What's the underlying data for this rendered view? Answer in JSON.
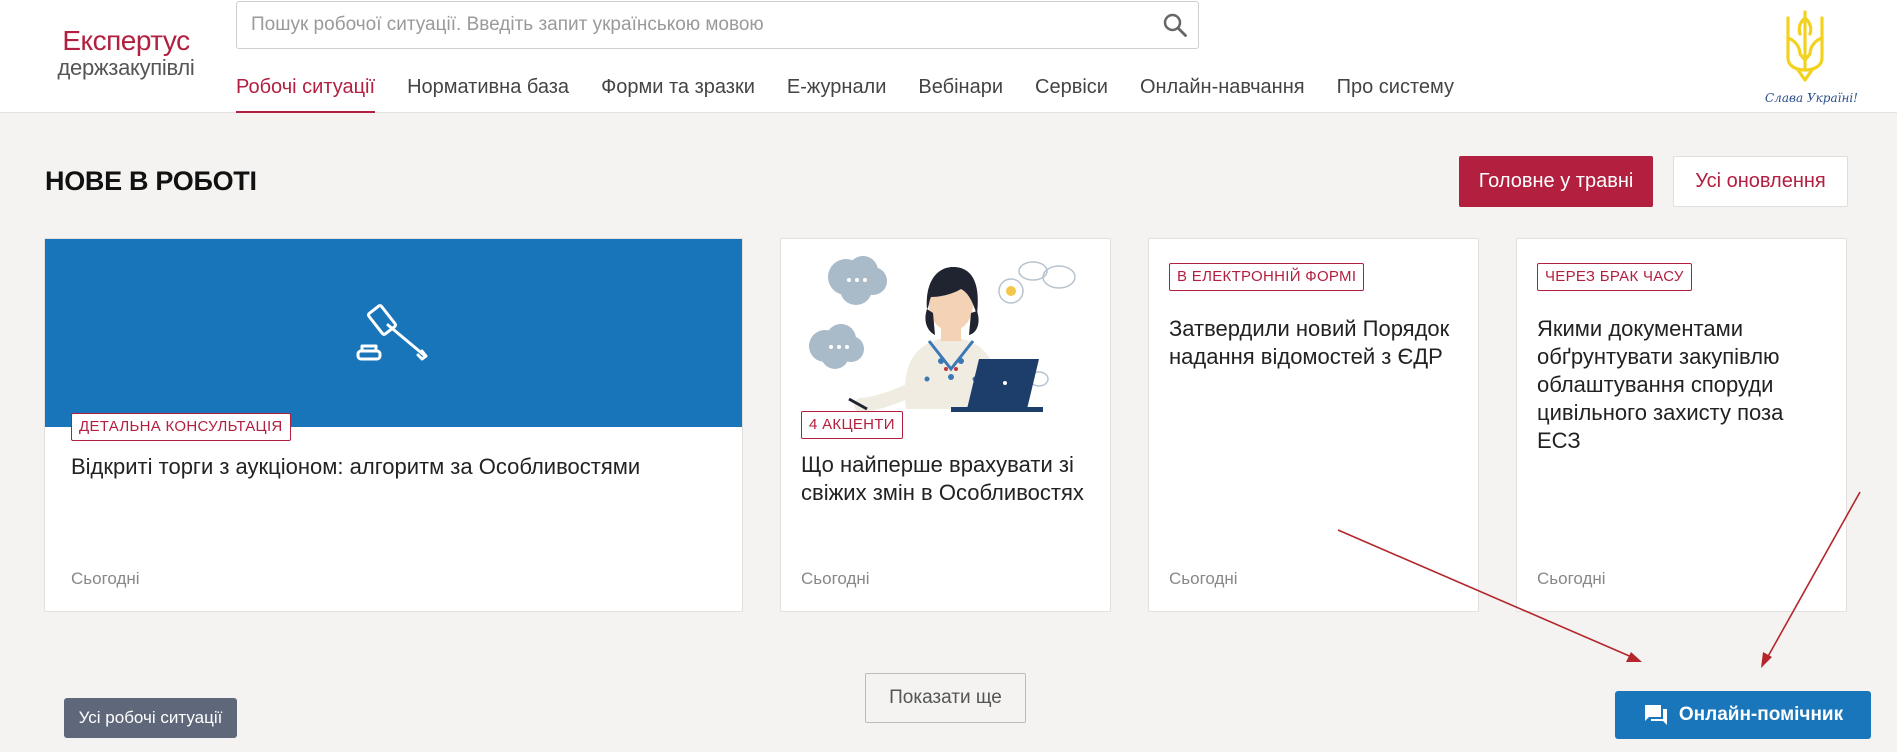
{
  "header": {
    "logo_line1": "Експертус",
    "logo_line2": "держзакупівлі",
    "search_placeholder": "Пошук робочої ситуації. Введіть запит українською мовою",
    "nav": [
      {
        "label": "Робочі ситуації",
        "active": true
      },
      {
        "label": "Нормативна база"
      },
      {
        "label": "Форми та зразки"
      },
      {
        "label": "Е-журнали"
      },
      {
        "label": "Вебінари"
      },
      {
        "label": "Сервіси"
      },
      {
        "label": "Онлайн-навчання"
      },
      {
        "label": "Про систему"
      }
    ],
    "slogan": "Слава Україні!"
  },
  "section": {
    "title": "НОВЕ В РОБОТІ",
    "btn_main": "Головне у травні",
    "btn_all_updates": "Усі оновлення"
  },
  "cards": [
    {
      "tag": "ДЕТАЛЬНА КОНСУЛЬТАЦІЯ",
      "title": "Відкриті торги з аукціоном: алгоритм за Особливостями",
      "date": "Сьогодні"
    },
    {
      "tag": "4 АКЦЕНТИ",
      "title": "Що найперше врахувати зі свіжих змін в Особливостях",
      "date": "Сьогодні"
    },
    {
      "tag": "В ЕЛЕКТРОННІЙ ФОРМІ",
      "title": "Затвердили новий Порядок надання відомостей з ЄДР",
      "date": "Сьогодні"
    },
    {
      "tag": "ЧЕРЕЗ БРАК ЧАСУ",
      "title": "Якими документами обґрунтувати закупівлю облаштування споруди цивільного захисту поза ЕСЗ",
      "date": "Сьогодні"
    }
  ],
  "bottom": {
    "btn_more": "Показати ще",
    "btn_all_situations": "Усі робочі ситуації",
    "btn_helper": "Онлайн-помічник"
  },
  "colors": {
    "brand": "#b21f3f",
    "banner_blue": "#1875b9",
    "helper_blue": "#1a76bb",
    "annotation_arrow": "#b3262b"
  },
  "icons": [
    "search-icon",
    "trident-icon",
    "gavel-icon",
    "chat-icon"
  ]
}
